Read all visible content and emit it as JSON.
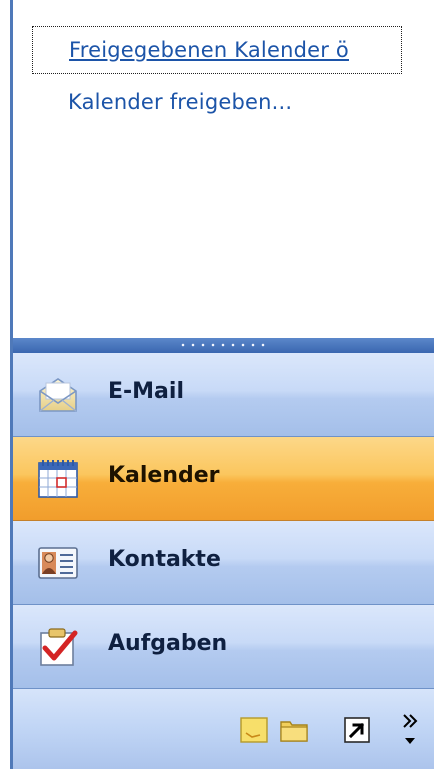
{
  "links": {
    "open_shared_calendar": "Freigegebenen Kalender ö",
    "share_calendar": "Kalender freigeben..."
  },
  "nav": {
    "items": [
      {
        "label": "E-Mail",
        "icon": "mail-icon",
        "active": false
      },
      {
        "label": "Kalender",
        "icon": "calendar-icon",
        "active": true
      },
      {
        "label": "Kontakte",
        "icon": "contacts-icon",
        "active": false
      },
      {
        "label": "Aufgaben",
        "icon": "tasks-icon",
        "active": false
      }
    ]
  },
  "toolbar": {
    "icons": [
      "notes-icon",
      "folder-list-icon",
      "shortcuts-icon",
      "configure-buttons-icon"
    ]
  },
  "colors": {
    "link": "#1c54a8",
    "accent_blue": "#3a67b0",
    "active_orange": "#f8ae3a"
  }
}
